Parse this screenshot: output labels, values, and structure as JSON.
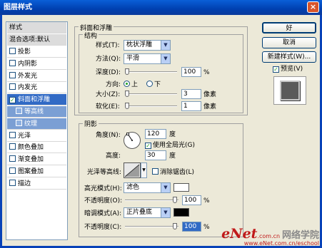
{
  "window": {
    "title": "图层样式",
    "close": "×"
  },
  "style_list": {
    "header": "样式",
    "blend": "混合选项:默认",
    "items": [
      {
        "label": "投影",
        "checked": false
      },
      {
        "label": "内阴影",
        "checked": false
      },
      {
        "label": "外发光",
        "checked": false
      },
      {
        "label": "内发光",
        "checked": false
      },
      {
        "label": "斜面和浮雕",
        "checked": true,
        "selected": true
      },
      {
        "label": "等高线",
        "checked": false,
        "sub": true
      },
      {
        "label": "纹理",
        "checked": false,
        "sub": true
      },
      {
        "label": "光泽",
        "checked": false
      },
      {
        "label": "颜色叠加",
        "checked": false
      },
      {
        "label": "渐变叠加",
        "checked": false
      },
      {
        "label": "图案叠加",
        "checked": false
      },
      {
        "label": "描边",
        "checked": false
      }
    ]
  },
  "bevel": {
    "group_title": "斜面和浮雕",
    "structure_title": "结构",
    "style_label": "样式(T):",
    "style_value": "枕状浮雕",
    "technique_label": "方法(Q):",
    "technique_value": "平滑",
    "depth_label": "深度(D):",
    "depth_value": "100",
    "depth_unit": "%",
    "depth_fraction": 0.0,
    "direction_label": "方向:",
    "dir_up": "上",
    "dir_down": "下",
    "size_label": "大小(Z):",
    "size_value": "3",
    "size_unit": "像素",
    "size_fraction": 0.0,
    "soften_label": "软化(E):",
    "soften_value": "1",
    "soften_unit": "像素",
    "soften_fraction": 0.0
  },
  "shading": {
    "title": "阴影",
    "angle_label": "角度(N):",
    "angle_value": "120",
    "angle_unit": "度",
    "global_light": "使用全局光(G)",
    "altitude_label": "高度:",
    "altitude_value": "30",
    "altitude_unit": "度",
    "gloss_label": "光泽等高线:",
    "anti_alias": "消除锯齿(L)",
    "highlight_mode_label": "高光模式(H):",
    "highlight_mode_value": "滤色",
    "highlight_color": "#ffffff",
    "opacity1_label": "不透明度(O):",
    "opacity1_value": "100",
    "opacity1_fraction": 1.0,
    "shadow_mode_label": "暗调模式(A):",
    "shadow_mode_value": "正片叠底",
    "shadow_color": "#000000",
    "opacity2_label": "不透明度(C):",
    "opacity2_value": "100",
    "opacity2_fraction": 1.0,
    "percent": "%"
  },
  "buttons": {
    "ok": "好",
    "cancel": "取消",
    "new_style": "新建样式(W)...",
    "preview": "预览(V)"
  },
  "watermark": {
    "brand": "eNet",
    "domain": ".com.cn",
    "cn": "网络学院",
    "url": "www.eNet.com.cn/eschool"
  }
}
